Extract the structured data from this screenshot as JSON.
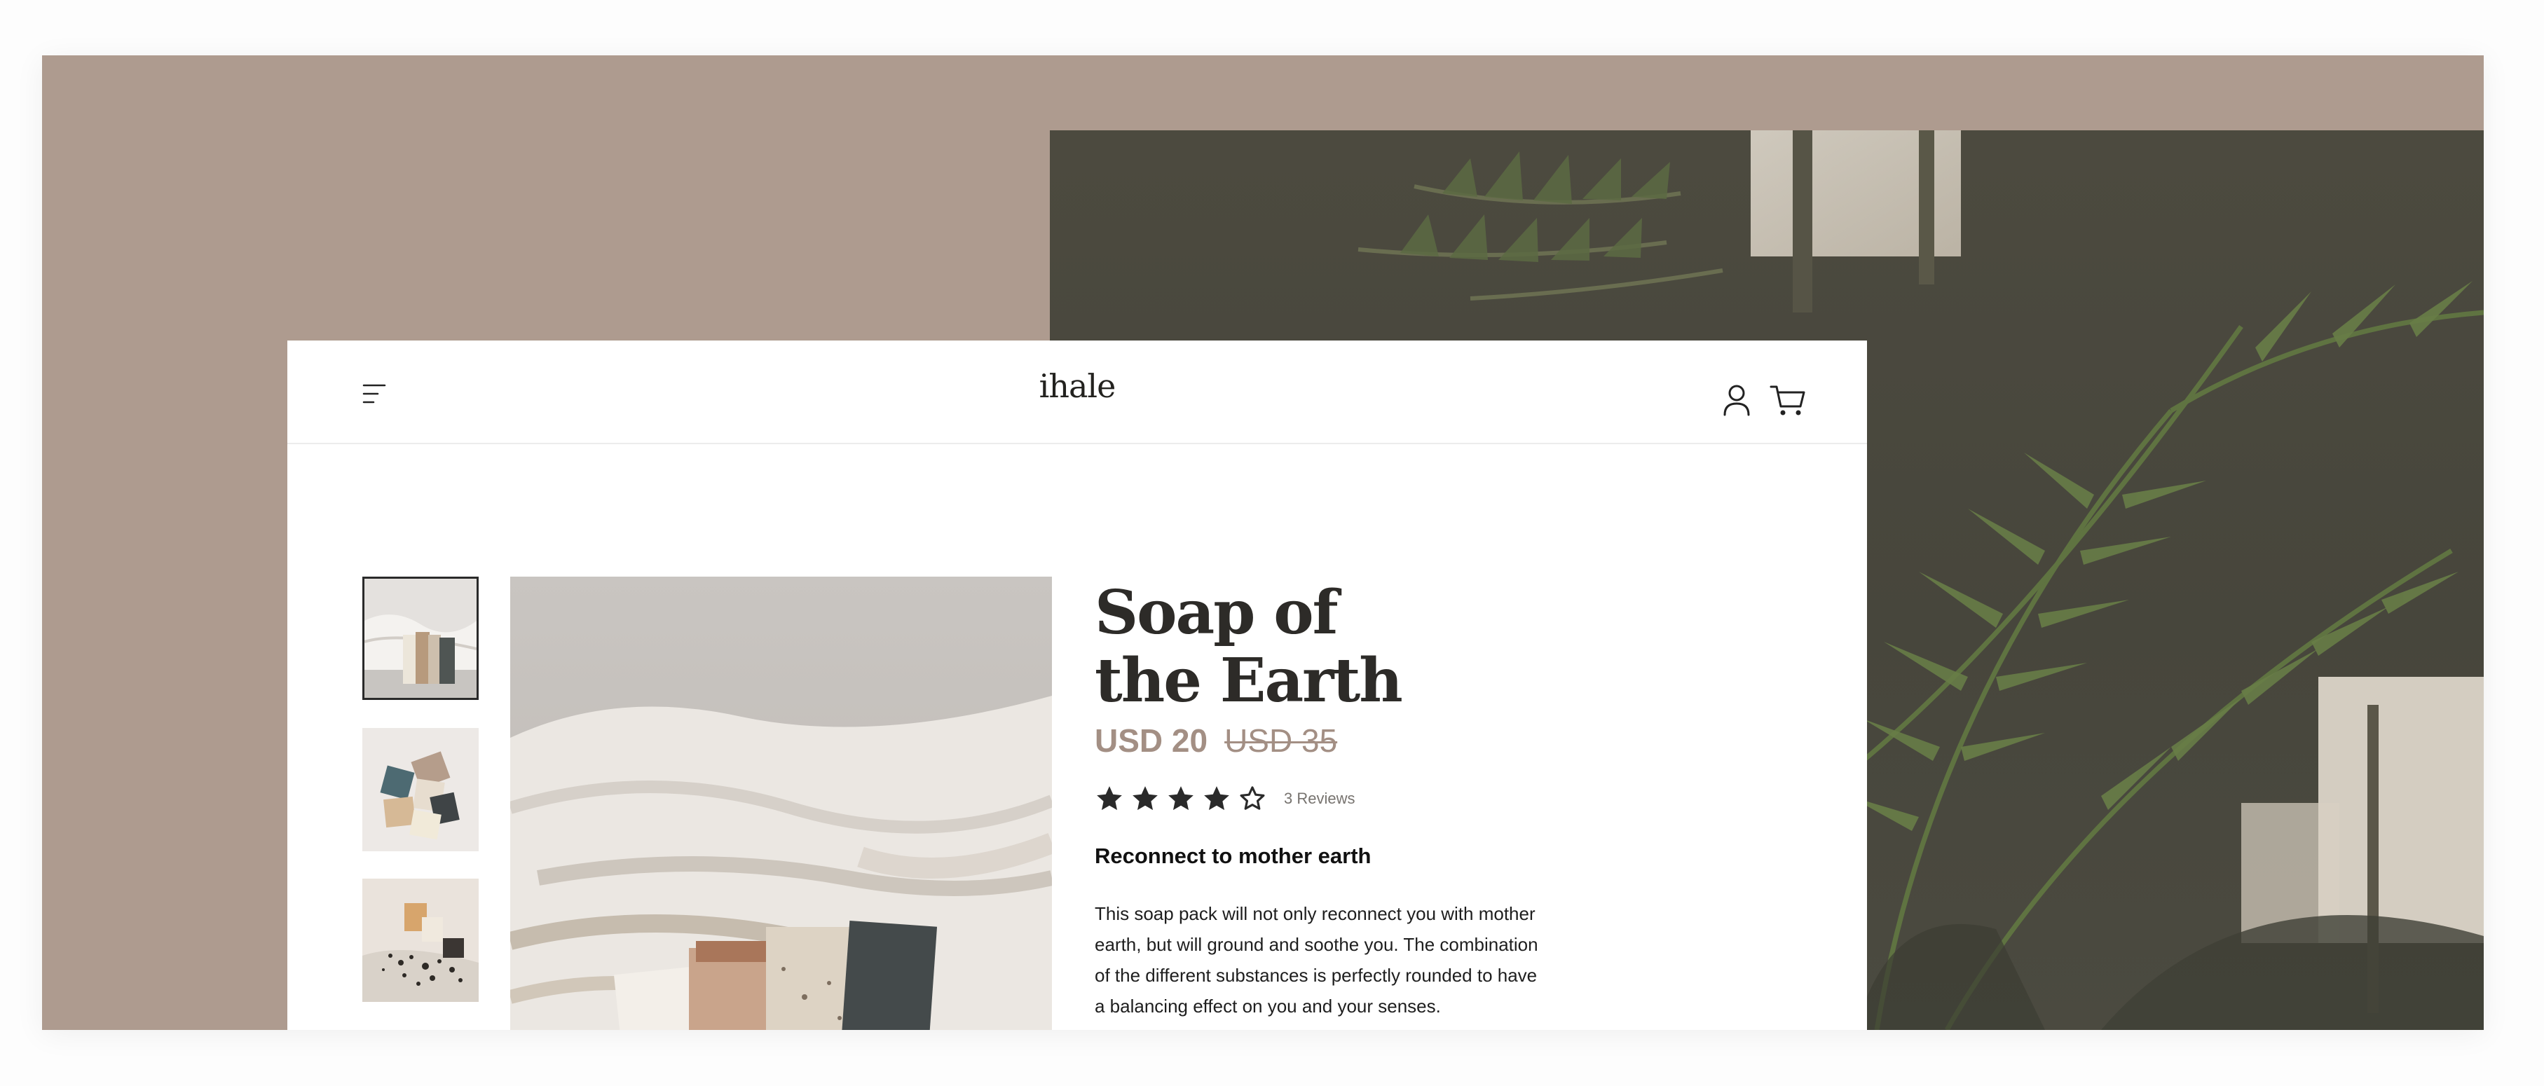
{
  "brand": {
    "logo_text": "ihale"
  },
  "header": {
    "icons": [
      "menu-icon",
      "user-icon",
      "cart-icon"
    ]
  },
  "product": {
    "title_line1": "Soap of",
    "title_line2": "the Earth",
    "price_current": "USD 20",
    "price_original": "USD 35",
    "rating": 4,
    "rating_max": 5,
    "reviews_label": "3 Reviews",
    "subtitle": "Reconnect to mother earth",
    "description": "This soap pack will not only reconnect you with mother earth, but will ground and soothe you. The combination of the different substances is perfectly rounded to have a balancing effect on you and your senses.",
    "thumbnails": [
      {
        "selected": true
      },
      {
        "selected": false
      },
      {
        "selected": false
      }
    ]
  },
  "colors": {
    "page_background": "#fdfdfd",
    "stage_background": "#ae9b8f",
    "card_background": "#ffffff",
    "accent_price": "#a38f84",
    "title_text": "#2d2b28",
    "star_fill": "#2a2a2a",
    "hero_dark": "#4b4a40",
    "frond_green": "#56683e"
  }
}
